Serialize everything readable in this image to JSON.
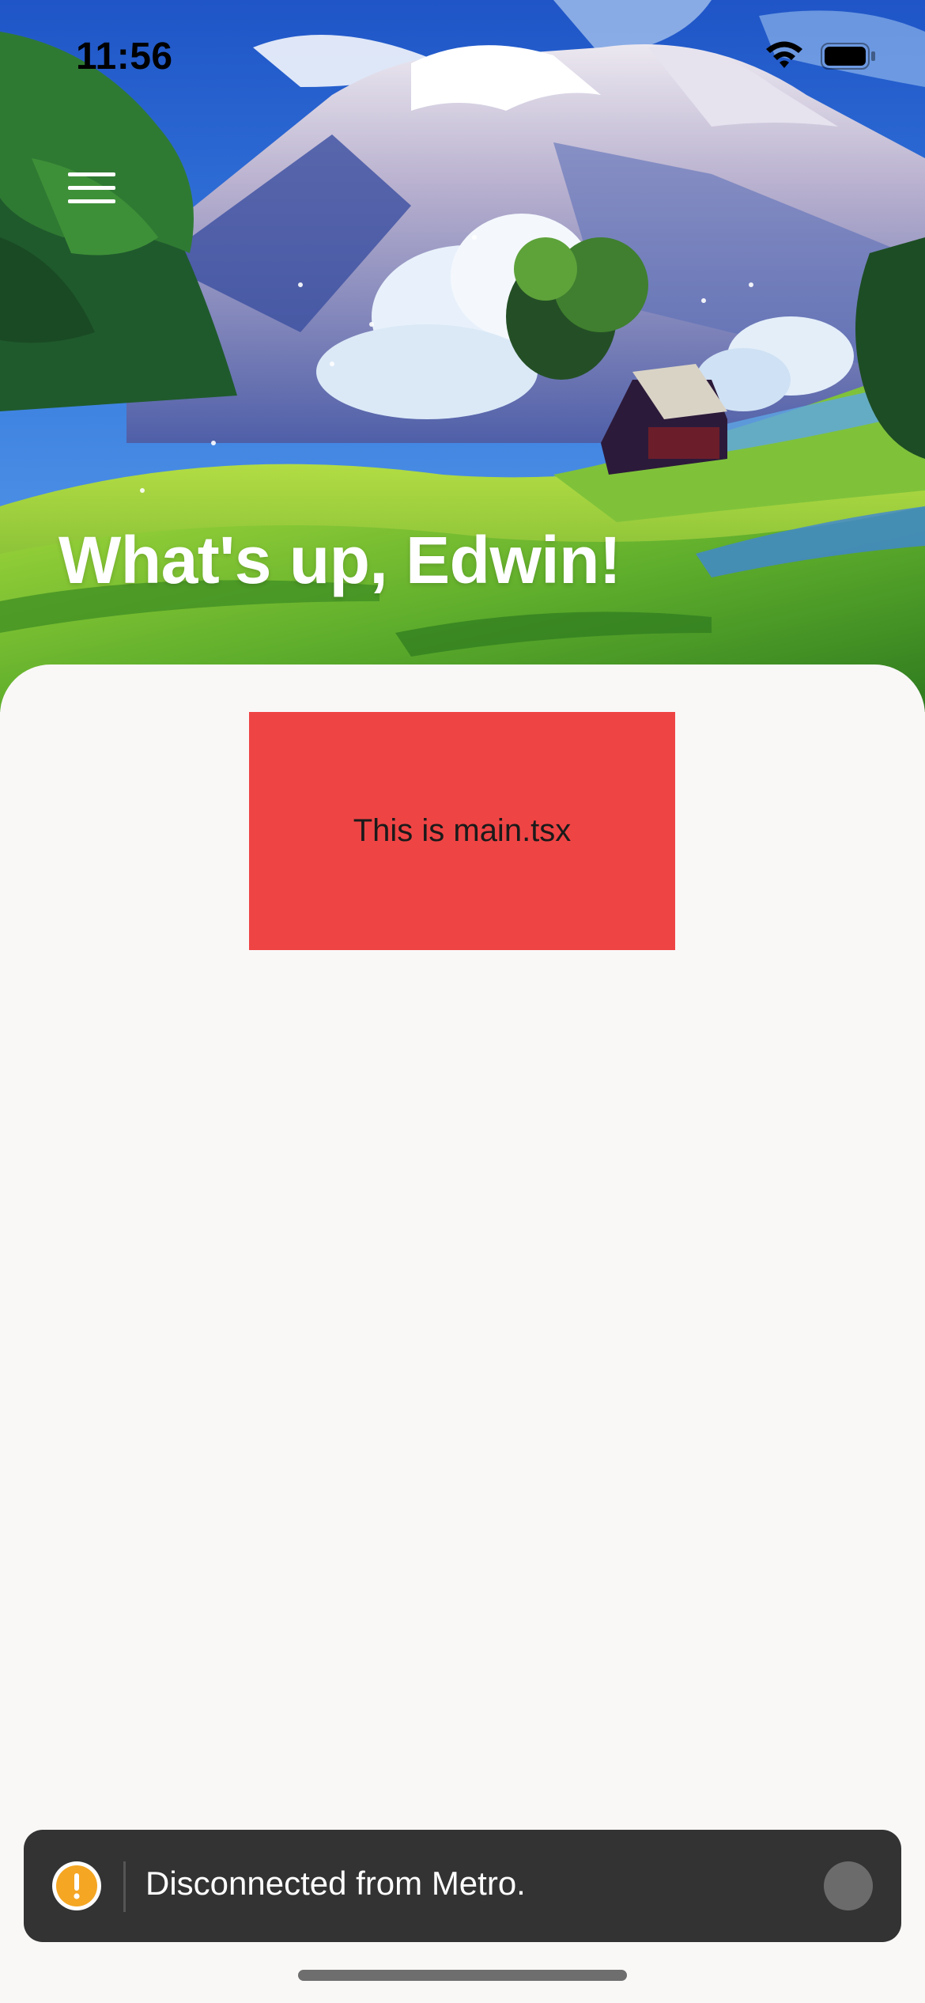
{
  "status_bar": {
    "time": "11:56",
    "icons": [
      "wifi-icon",
      "battery-icon"
    ]
  },
  "header": {
    "menu_icon": "hamburger-menu-icon",
    "greeting": "What's up, Edwin!",
    "background": "illustrated-landscape"
  },
  "main": {
    "box_text": "This is main.tsx",
    "box_color": "#ef4444"
  },
  "toast": {
    "icon": "warning-icon",
    "message": "Disconnected from Metro.",
    "icon_color": "#f5a623"
  },
  "colors": {
    "sheet_background": "#f9f8f7",
    "toast_background": "#333333",
    "sky": "#2a5fc8"
  }
}
